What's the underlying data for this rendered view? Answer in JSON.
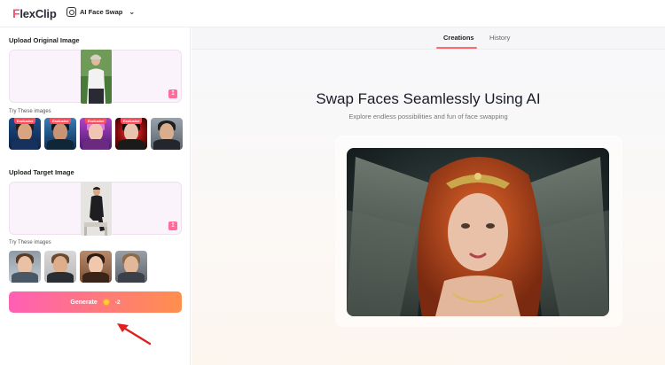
{
  "header": {
    "logo_initial": "F",
    "logo_rest": "lexClip",
    "tool_name": "AI Face Swap"
  },
  "left": {
    "original": {
      "title": "Upload Original Image",
      "try_label": "Try These images",
      "samples": [
        {
          "name": "sample-original-1",
          "badge": "Exclusive"
        },
        {
          "name": "sample-original-2",
          "badge": "Exclusive"
        },
        {
          "name": "sample-original-3",
          "badge": "Exclusive"
        },
        {
          "name": "sample-original-4",
          "badge": "Exclusive"
        },
        {
          "name": "sample-original-5",
          "badge": ""
        }
      ]
    },
    "target": {
      "title": "Upload Target Image",
      "try_label": "Try These images"
    },
    "generate": {
      "label": "Generate",
      "cost": "-2"
    }
  },
  "right": {
    "tabs": [
      "Creations",
      "History"
    ],
    "active_tab": "Creations",
    "title": "Swap Faces Seamlessly Using AI",
    "subtitle": "Explore endless possibilities and fun of face swapping"
  },
  "colors": {
    "brand": "#ff4d6d",
    "accent_gradient_start": "#ff5fb5",
    "accent_gradient_end": "#ff8f4d",
    "annotation_arrow": "#e02020"
  },
  "icons": {
    "tool": "face-swap-icon",
    "dropdown": "chevron-down-icon",
    "upload": "upload-icon",
    "coin": "coin-icon"
  }
}
